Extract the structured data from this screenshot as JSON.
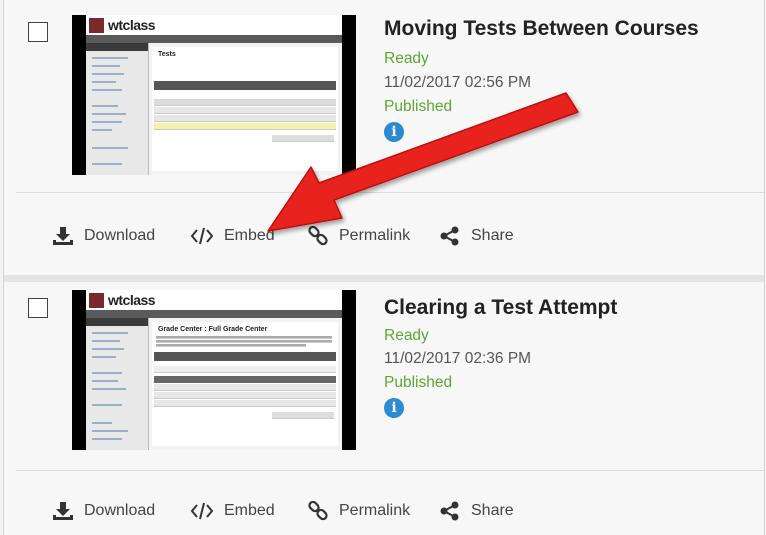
{
  "items": [
    {
      "title": "Moving Tests Between Courses",
      "status": "Ready",
      "date": "11/02/2017 02:56 PM",
      "publish_state": "Published",
      "thumbnail_logo": "wtclass",
      "actions": [
        {
          "label": "Download",
          "icon": "download-icon"
        },
        {
          "label": "Embed",
          "icon": "code-icon"
        },
        {
          "label": "Permalink",
          "icon": "link-icon"
        },
        {
          "label": "Share",
          "icon": "share-icon"
        }
      ]
    },
    {
      "title": "Clearing a Test Attempt",
      "status": "Ready",
      "date": "11/02/2017 02:36 PM",
      "publish_state": "Published",
      "thumbnail_logo": "wtclass",
      "actions": [
        {
          "label": "Download",
          "icon": "download-icon"
        },
        {
          "label": "Embed",
          "icon": "code-icon"
        },
        {
          "label": "Permalink",
          "icon": "link-icon"
        },
        {
          "label": "Share",
          "icon": "share-icon"
        }
      ]
    }
  ],
  "thumb1_screen_title": "Tests",
  "thumb2_screen_title": "Grade Center : Full Grade Center",
  "colors": {
    "status_green": "#5aa832",
    "info_blue": "#2a8ad4",
    "annotation_arrow": "#e8201c"
  }
}
